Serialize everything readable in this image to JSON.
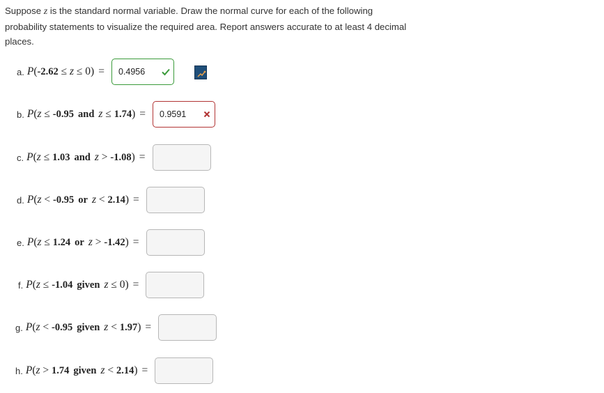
{
  "intro": {
    "part1": "Suppose ",
    "var": "z",
    "part2": " is the standard normal variable. Draw the normal curve for each of the following probability statements to visualize the required area. Report answers accurate to at least 4 decimal places."
  },
  "questions": [
    {
      "letter": "a.",
      "value": "0.4956",
      "status": "correct"
    },
    {
      "letter": "b.",
      "value": "0.9591",
      "status": "incorrect"
    },
    {
      "letter": "c.",
      "value": "",
      "status": "empty"
    },
    {
      "letter": "d.",
      "value": "",
      "status": "empty"
    },
    {
      "letter": "e.",
      "value": "",
      "status": "empty"
    },
    {
      "letter": "f.",
      "value": "",
      "status": "empty"
    },
    {
      "letter": "g.",
      "value": "",
      "status": "empty"
    },
    {
      "letter": "h.",
      "value": "",
      "status": "empty"
    }
  ],
  "math": {
    "P": "P",
    "z": "z",
    "open": "(",
    "close": ")",
    "eq": "=",
    "le": "≤",
    "lt": "<",
    "gt": ">",
    "and": "and",
    "or": "or",
    "given": "given",
    "a": {
      "low": "-2.62",
      "high": "0"
    },
    "b": {
      "v1": "-0.95",
      "v2": "1.74"
    },
    "c": {
      "v1": "1.03",
      "v2": "-1.08"
    },
    "d": {
      "v1": "-0.95",
      "v2": "2.14"
    },
    "e": {
      "v1": "1.24",
      "v2": "-1.42"
    },
    "f": {
      "v1": "-1.04",
      "v2": "0"
    },
    "g": {
      "v1": "-0.95",
      "v2": "1.97"
    },
    "h": {
      "v1": "1.74",
      "v2": "2.14"
    }
  },
  "colors": {
    "correct": "#3a9a3a",
    "incorrect": "#b23434",
    "hint_button": "#1f4e79"
  },
  "icons": {
    "correct": "check-icon",
    "incorrect": "x-icon",
    "hint": "graph-hint-icon"
  }
}
